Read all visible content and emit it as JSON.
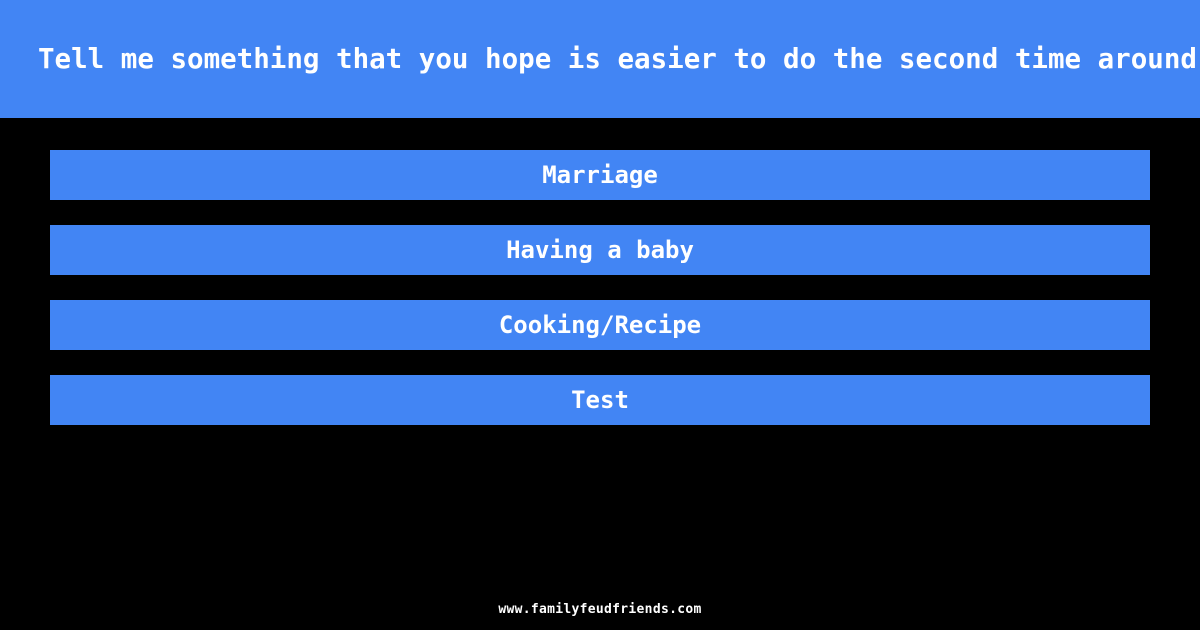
{
  "theme": {
    "background_color": "#000000",
    "accent_color": "#4285f4",
    "text_color": "#ffffff"
  },
  "header": {
    "question": "Tell me something that you hope is easier to do the second time around"
  },
  "answers": [
    {
      "text": "Marriage"
    },
    {
      "text": "Having a baby"
    },
    {
      "text": "Cooking/Recipe"
    },
    {
      "text": "Test"
    }
  ],
  "footer": {
    "site": "www.familyfeudfriends.com"
  }
}
